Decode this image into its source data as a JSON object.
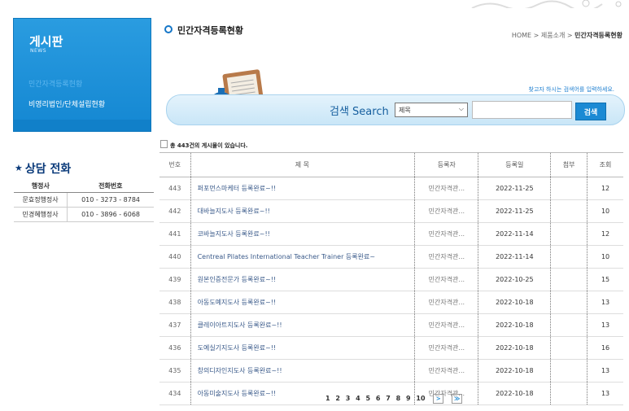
{
  "sidebar": {
    "board_title": "게시판",
    "board_sub": "NEWS",
    "links": [
      "민간자격등록현황",
      "비영리법인/단체설립현황"
    ],
    "consult_title": "상담 전화",
    "contacts_header": [
      "행정사",
      "전화번호"
    ],
    "contacts": [
      [
        "문효정행정사",
        "010 - 3273 - 8784"
      ],
      [
        "민경혜행정사",
        "010 - 3896 - 6068"
      ]
    ]
  },
  "header": {
    "title": "민간자격등록현황",
    "breadcrumb_prefix": "HOME > 제품소개 > ",
    "breadcrumb_current": "민간자격등록현황"
  },
  "search": {
    "hint": "찾고자 하시는 검색어를 입력하세요.",
    "label": "검색 Search",
    "field_selected": "제목",
    "button": "검색",
    "query": ""
  },
  "list": {
    "note": "총 443건의 게시물이 있습니다.",
    "columns": [
      "번호",
      "제 목",
      "등록자",
      "등록일",
      "첨부",
      "조회"
    ],
    "rows": [
      [
        "443",
        "퍼포먼스마케터 등록완료~!!",
        "민간자격관...",
        "2022-11-25",
        "",
        "12"
      ],
      [
        "442",
        "대바늘지도사 등록완료~!!",
        "민간자격관...",
        "2022-11-25",
        "",
        "10"
      ],
      [
        "441",
        "코바늘지도사 등록완료~!!",
        "민간자격관...",
        "2022-11-14",
        "",
        "12"
      ],
      [
        "440",
        "Centreal Pilates International Teacher Trainer 등록완료~",
        "민간자격관...",
        "2022-11-14",
        "",
        "10"
      ],
      [
        "439",
        "원본인증전문가 등록완료~!!",
        "민간자격관...",
        "2022-10-25",
        "",
        "15"
      ],
      [
        "438",
        "아동도예지도사 등록완료~!!",
        "민간자격관...",
        "2022-10-18",
        "",
        "13"
      ],
      [
        "437",
        "클레이아트지도사 등록완료~!!",
        "민간자격관...",
        "2022-10-18",
        "",
        "13"
      ],
      [
        "436",
        "도예실기지도사 등록완료~!!",
        "민간자격관...",
        "2022-10-18",
        "",
        "16"
      ],
      [
        "435",
        "창의디자인지도사 등록완료~!!",
        "민간자격관...",
        "2022-10-18",
        "",
        "13"
      ],
      [
        "434",
        "아동미술지도사 등록완료~!!",
        "민간자격관...",
        "2022-10-18",
        "",
        "13"
      ]
    ]
  },
  "pagination": {
    "pages": [
      "1",
      "2",
      "3",
      "4",
      "5",
      "6",
      "7",
      "8",
      "9",
      "10"
    ],
    "next": ">",
    "last": "≫"
  },
  "colors": {
    "accent": "#1b8ad4",
    "sidebar_bg": "#1487d2",
    "consult_title": "#0a3a7a"
  }
}
